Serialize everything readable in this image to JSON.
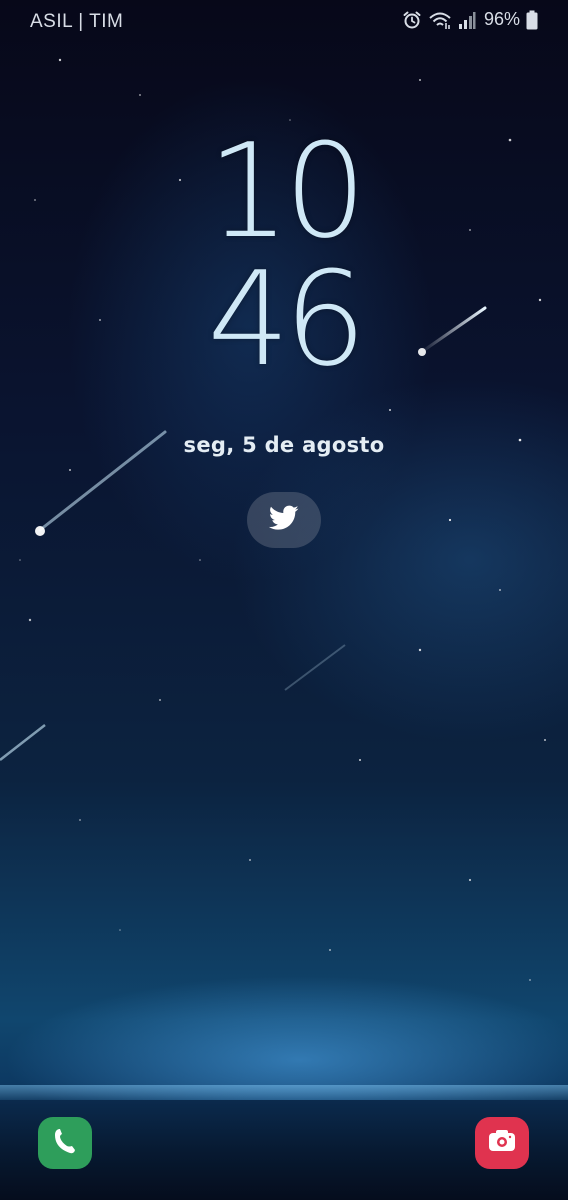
{
  "status_bar": {
    "carrier": "ASIL | TIM",
    "battery": "96%",
    "icons": [
      "alarm-icon",
      "wifi-icon",
      "signal-icon",
      "battery-icon"
    ]
  },
  "lockscreen": {
    "hours": "10",
    "minutes": "46",
    "date": "seg, 5 de agosto",
    "notification_icons": [
      "twitter-icon"
    ]
  },
  "shortcuts": {
    "left": "phone-icon",
    "right": "camera-icon"
  },
  "colors": {
    "clock": "#cfe8f6",
    "phone_shortcut": "#2e9e5b",
    "camera_shortcut": "#e0334f"
  }
}
